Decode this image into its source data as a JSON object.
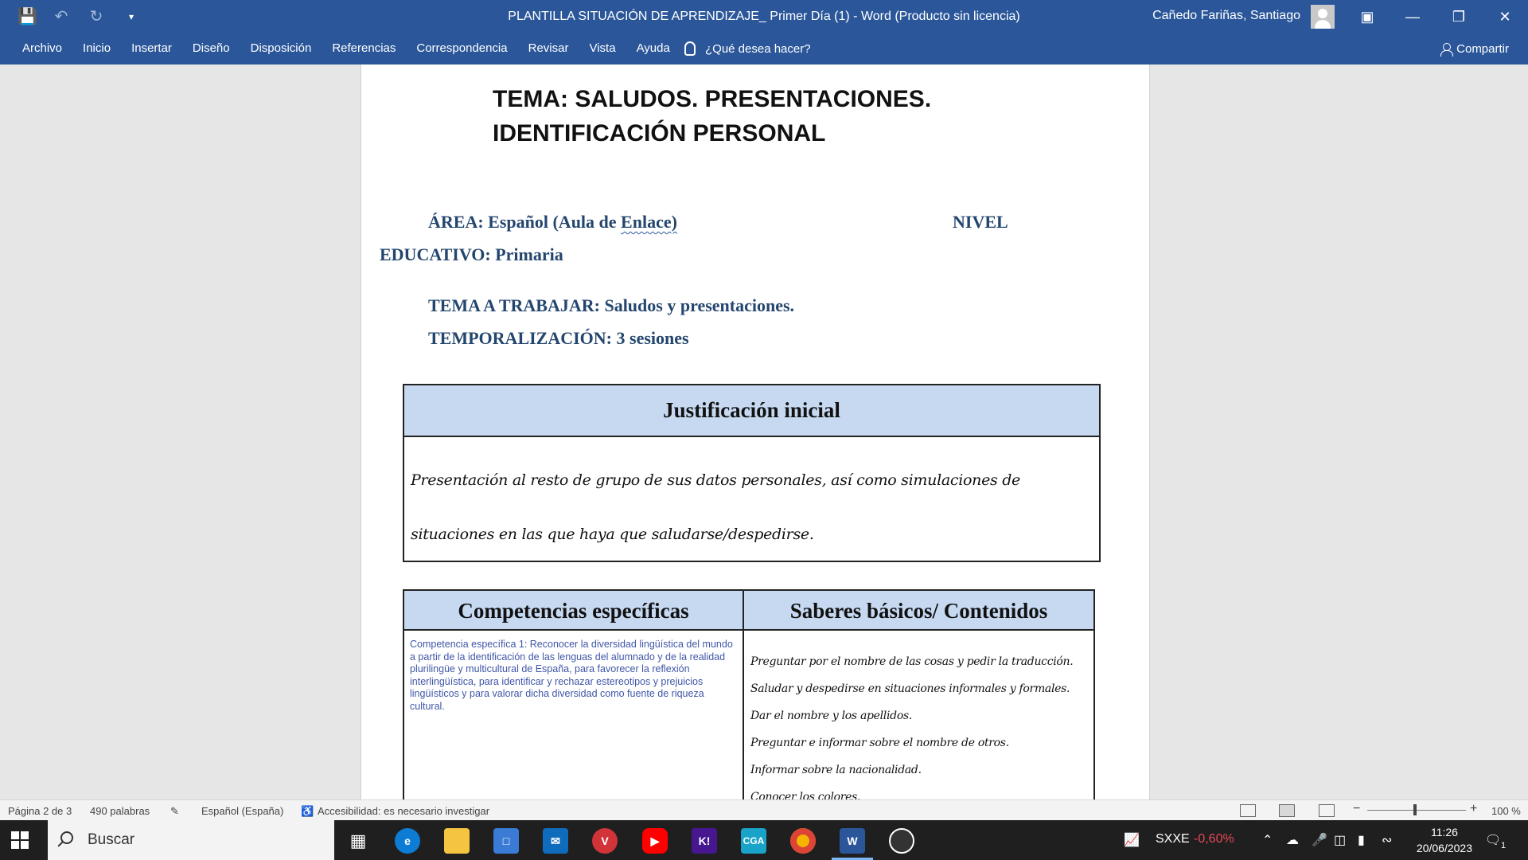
{
  "titlebar": {
    "title": "PLANTILLA SITUACIÓN DE APRENDIZAJE_ Primer Día (1)  -  Word (Producto sin licencia)",
    "user": "Cañedo Fariñas, Santiago",
    "qat_icons": [
      "save-icon",
      "undo-icon",
      "redo-icon",
      "customize-icon"
    ],
    "window_buttons": [
      "ribbon-display-icon",
      "minimize-icon",
      "restore-icon",
      "close-icon"
    ]
  },
  "ribbon": {
    "tabs": [
      "Archivo",
      "Inicio",
      "Insertar",
      "Diseño",
      "Disposición",
      "Referencias",
      "Correspondencia",
      "Revisar",
      "Vista",
      "Ayuda"
    ],
    "tell_me": "¿Qué desea hacer?",
    "share": "Compartir"
  },
  "document": {
    "tema_line1": "TEMA: SALUDOS. PRESENTACIONES.",
    "tema_line2": "IDENTIFICACIÓN PERSONAL",
    "area_prefix": "ÁREA: Español (Aula de ",
    "area_squiggle": "Enlace)",
    "nivel": "NIVEL",
    "educativo": "EDUCATIVO:  Primaria",
    "tema_trabajar": "TEMA A TRABAJAR: Saludos y presentaciones.",
    "temporalizacion": "TEMPORALIZACIÓN: 3 sesiones",
    "justificacion": {
      "header": "Justificación inicial",
      "body": "Presentación al resto de grupo de sus datos personales, así como simulaciones de situaciones en las que haya que saludarse/despedirse."
    },
    "competencias": {
      "header_left": "Competencias específicas",
      "header_right": "Saberes básicos/ Contenidos",
      "competencia_text": "Competencia específica 1: Reconocer la diversidad lingüística del mundo a partir de la identificación de las lenguas del alumnado y de la realidad plurilingüe y multicultural de España, para favorecer la reflexión interlingüística, para identificar y rechazar estereotipos y prejuicios lingüísticos y para valorar dicha diversidad como fuente de riqueza cultural.",
      "saberes": [
        "Preguntar por el nombre de las cosas y pedir la traducción.",
        "Saludar y despedirse en situaciones informales y formales.",
        "Dar el nombre y los apellidos.",
        "Preguntar e informar sobre el nombre de otros.",
        "Informar sobre la nacionalidad.",
        "Conocer los colores."
      ]
    }
  },
  "statusbar": {
    "page": "Página 2 de 3",
    "words": "490 palabras",
    "language": "Español (España)",
    "accessibility": "Accesibilidad: es necesario investigar",
    "zoom": "100 %"
  },
  "taskbar": {
    "search_placeholder": "Buscar",
    "apps": [
      "task-view-icon",
      "edge-icon",
      "file-explorer-icon",
      "store-icon",
      "mail-icon",
      "remote-app-icon",
      "youtube-icon",
      "kahoot-icon",
      "cga-icon",
      "chrome-icon",
      "word-icon",
      "screen-recorder-icon"
    ],
    "stock_label": "SXXE",
    "stock_change": "-0,60%",
    "time": "11:26",
    "date": "20/06/2023",
    "notification_count": "1"
  },
  "colors": {
    "word_blue": "#2b579a",
    "table_header": "#c6d9f1",
    "field_text": "#24466e",
    "stock_negative": "#e74856"
  }
}
